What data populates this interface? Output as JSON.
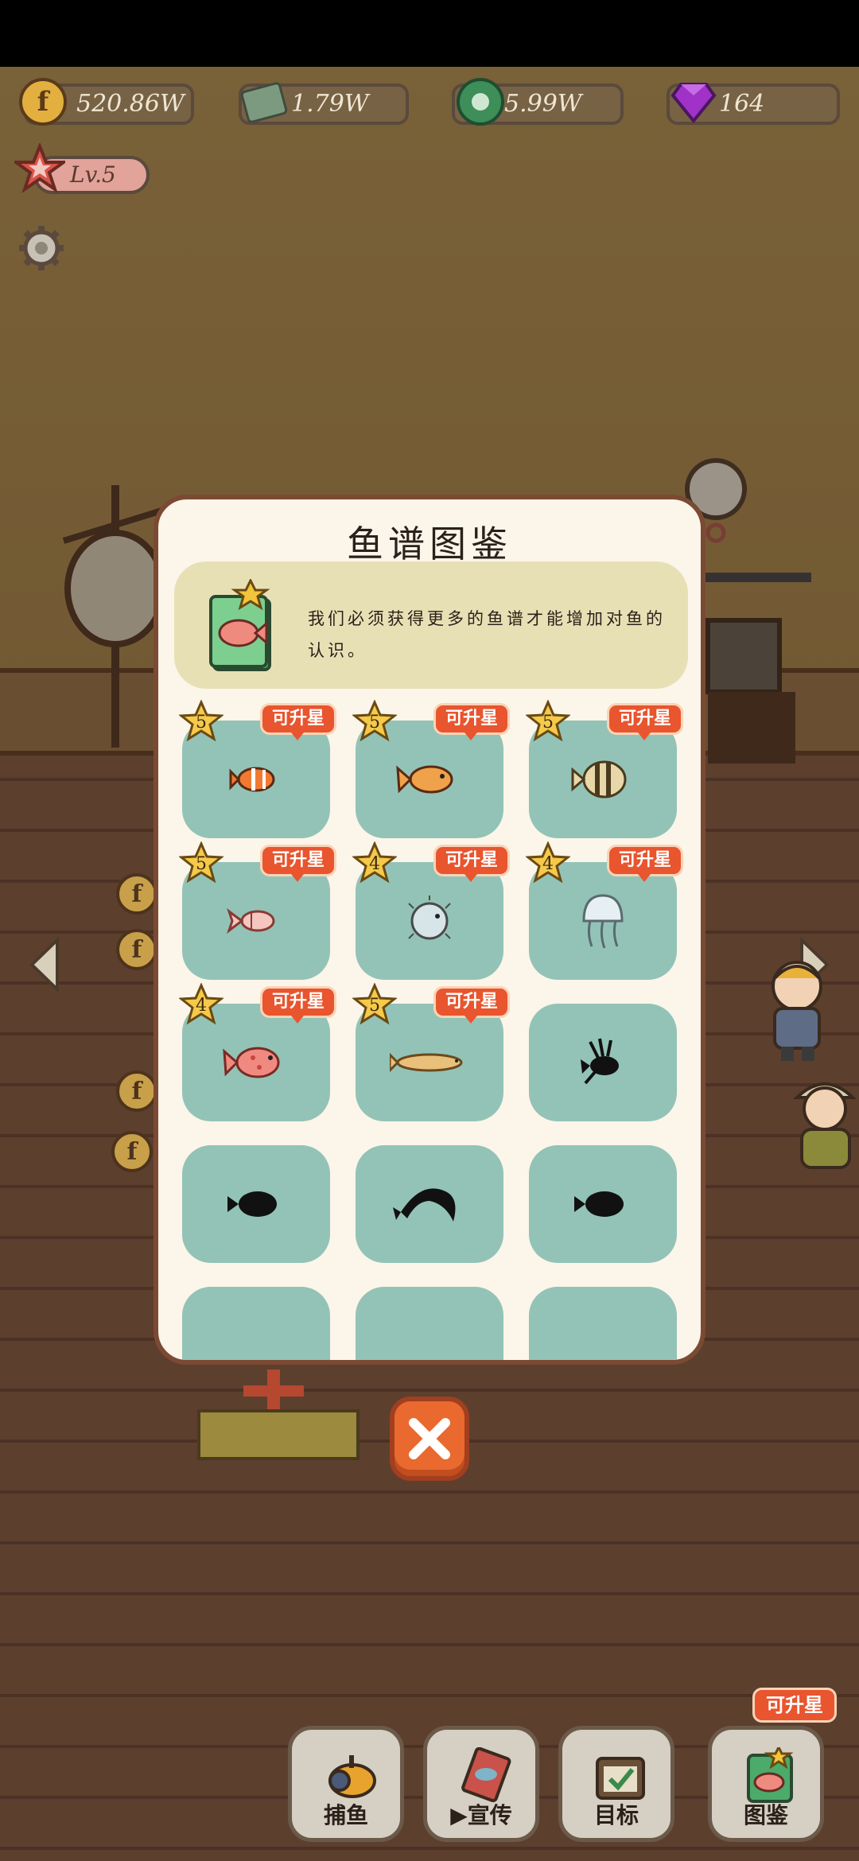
{
  "hud": {
    "coins": "520.86W",
    "cash": "1.79W",
    "rings": "5.99W",
    "gems": "164",
    "level": "Lv.5"
  },
  "dialog": {
    "title": "鱼谱图鉴",
    "description": "我们必须获得更多的鱼谱才能增加对鱼的认识。",
    "upgrade_label": "可升星",
    "fish": [
      {
        "stars": "5",
        "upgradable": true,
        "unlocked": true,
        "icon": "clownfish-icon"
      },
      {
        "stars": "5",
        "upgradable": true,
        "unlocked": true,
        "icon": "goldfish-icon"
      },
      {
        "stars": "5",
        "upgradable": true,
        "unlocked": true,
        "icon": "butterflyfish-icon"
      },
      {
        "stars": "5",
        "upgradable": true,
        "unlocked": true,
        "icon": "angelfish-icon"
      },
      {
        "stars": "4",
        "upgradable": true,
        "unlocked": true,
        "icon": "pufferfish-icon"
      },
      {
        "stars": "4",
        "upgradable": true,
        "unlocked": true,
        "icon": "jellyfish-icon"
      },
      {
        "stars": "4",
        "upgradable": true,
        "unlocked": true,
        "icon": "grouper-icon"
      },
      {
        "stars": "5",
        "upgradable": true,
        "unlocked": true,
        "icon": "arowana-icon"
      },
      {
        "stars": "",
        "upgradable": false,
        "unlocked": false,
        "icon": "lionfish-silhouette-icon"
      },
      {
        "stars": "",
        "upgradable": false,
        "unlocked": false,
        "icon": "fish-silhouette-icon"
      },
      {
        "stars": "",
        "upgradable": false,
        "unlocked": false,
        "icon": "leaping-fish-silhouette-icon"
      },
      {
        "stars": "",
        "upgradable": false,
        "unlocked": false,
        "icon": "fish-silhouette-icon"
      }
    ]
  },
  "nav": {
    "fishing": "捕鱼",
    "promote": "宣传",
    "goals": "目标",
    "catalog": "图鉴",
    "catalog_badge": "可升星"
  },
  "colors": {
    "card_bg": "#93c3b6",
    "dialog_bg": "#fbf5ea",
    "upgrade_tag": "#e8552e",
    "close_button": "#e9692f"
  }
}
